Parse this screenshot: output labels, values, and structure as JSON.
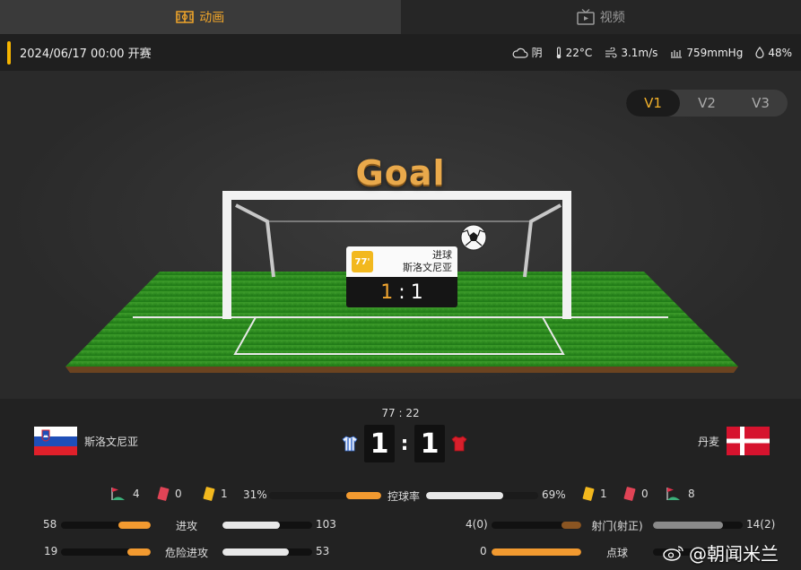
{
  "tabs": [
    {
      "label": "动画",
      "icon": "pitch-icon",
      "active": true
    },
    {
      "label": "视频",
      "icon": "tv-icon",
      "active": false
    }
  ],
  "info": {
    "datetime": "2024/06/17 00:00 开赛",
    "weather": "阴",
    "temperature": "22°C",
    "wind": "3.1m/s",
    "pressure": "759mmHg",
    "humidity": "48%"
  },
  "view_switch": {
    "options": [
      "V1",
      "V2",
      "V3"
    ],
    "selected": "V1"
  },
  "animation": {
    "headline": "Goal",
    "event_minute": "77'",
    "event_type": "进球",
    "event_team": "斯洛文尼亚",
    "event_score_home": "1",
    "event_score_away": "1",
    "event_score_sep": ":"
  },
  "match": {
    "clock": "77 : 22",
    "home_team": "斯洛文尼亚",
    "away_team": "丹麦",
    "home_score": "1",
    "away_score": "1",
    "score_sep": ":"
  },
  "stats": {
    "home_corners": "4",
    "home_red": "0",
    "home_yellow": "1",
    "away_yellow": "1",
    "away_red": "0",
    "away_corners": "8",
    "possession_label": "控球率",
    "home_possession": "31%",
    "away_possession": "69%",
    "home_possession_value": 31,
    "away_possession_value": 69,
    "left": [
      {
        "label": "进攻",
        "home": "58",
        "away": "103",
        "home_value": 58,
        "away_value": 103
      },
      {
        "label": "危险进攻",
        "home": "19",
        "away": "53",
        "home_value": 19,
        "away_value": 53
      }
    ],
    "right": [
      {
        "label": "射门(射正)",
        "home": "4(0)",
        "away": "14(2)",
        "home_value": 4,
        "away_value": 14
      },
      {
        "label": "点球",
        "home": "0",
        "away": "",
        "home_value": 0,
        "away_value": 0
      }
    ]
  },
  "colors": {
    "accent": "#f0a52a",
    "home_bar": "#f29a30",
    "away_bar": "#e8e8e8",
    "shots_home": "#8a5522",
    "shots_away": "#8a8a8a"
  },
  "watermark": "@朝闻米兰"
}
